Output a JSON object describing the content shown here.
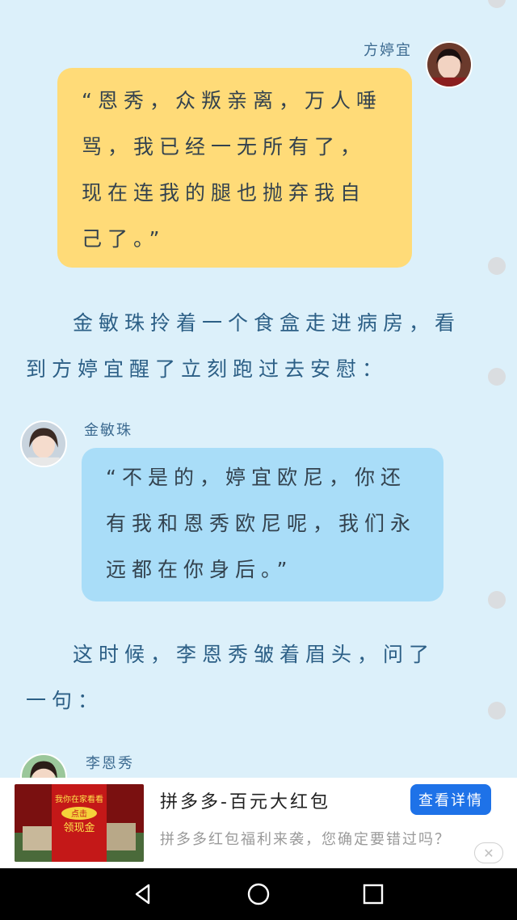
{
  "conversation": {
    "messages": [
      {
        "speaker": "方婷宜",
        "text": "“恩秀，众叛亲离，万人唾骂，我已经一无所有了，现在连我的腿也抛弃我自己了。”"
      },
      {
        "speaker": "金敏珠",
        "text": "“不是的，婷宜欧尼，你还有我和恩秀欧尼呢，我们永远都在你身后。”"
      },
      {
        "speaker": "李恩秀",
        "text": ""
      }
    ],
    "narration": [
      "金敏珠拎着一个食盒走进病房，看到方婷宜醒了立刻跑过去安慰：",
      "这时候，李恩秀皱着眉头，问了一句："
    ]
  },
  "ad": {
    "title": "拼多多-百元大红包",
    "description": "拼多多红包福利来袭，您确定要错过吗？",
    "button_label": "查看详情",
    "image_text_top": "我你在家看看",
    "image_text_mid": "点击",
    "image_text_bottom": "领现金",
    "close_symbol": "✕"
  },
  "navbar": {
    "icons": [
      "back-icon",
      "home-icon",
      "recents-icon"
    ]
  },
  "colors": {
    "background": "#dcf0fa",
    "bubble_left": "#a9ddf8",
    "bubble_right": "#ffdb78",
    "accent": "#1e72e8"
  }
}
